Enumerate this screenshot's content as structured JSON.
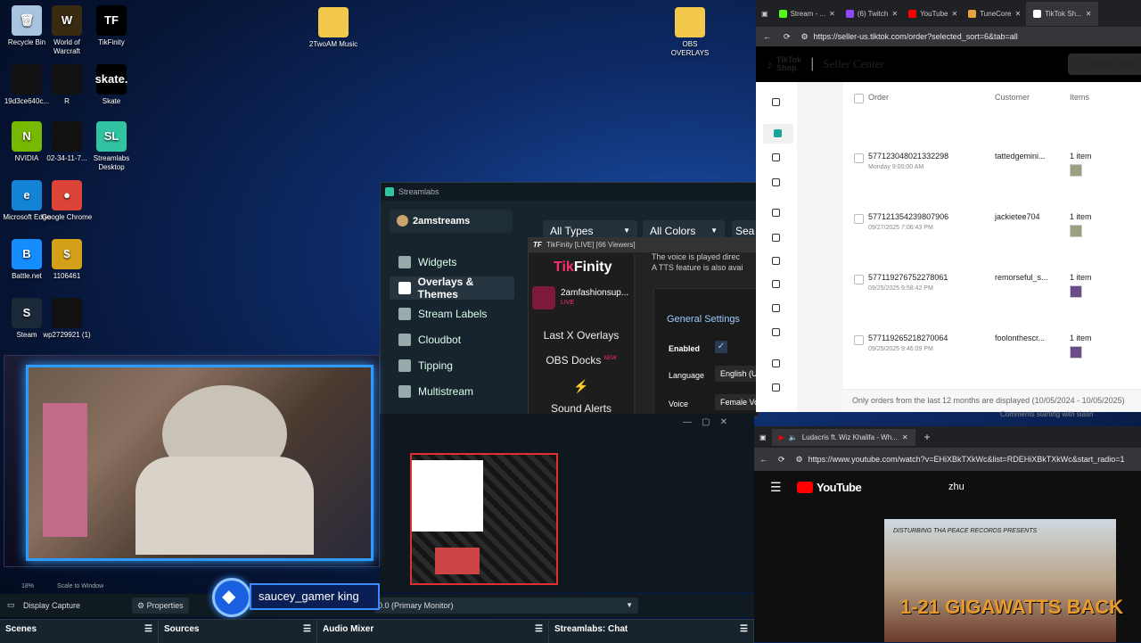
{
  "desktop": {
    "icons": [
      {
        "label": "Recycle Bin",
        "glyph": "🗑",
        "color": "#a8c4e0"
      },
      {
        "label": "World of Warcraft",
        "glyph": "W",
        "color": "#3a2a10"
      },
      {
        "label": "TikFinity",
        "glyph": "TF",
        "color": "#000000"
      },
      {
        "label": "19d3ce640c...",
        "glyph": "",
        "color": "#111111"
      },
      {
        "label": "R",
        "glyph": "",
        "color": "#111111"
      },
      {
        "label": "Skate",
        "glyph": "skate.",
        "color": "#000000"
      },
      {
        "label": "NVIDIA",
        "glyph": "N",
        "color": "#76b900"
      },
      {
        "label": "02-34-11-7...",
        "glyph": "",
        "color": "#111111"
      },
      {
        "label": "Streamlabs Desktop",
        "glyph": "SL",
        "color": "#31c3a2"
      },
      {
        "label": "Microsoft Edge",
        "glyph": "e",
        "color": "#1383d6"
      },
      {
        "label": "Google Chrome",
        "glyph": "●",
        "color": "#db4437"
      },
      {
        "label": "Battle.net",
        "glyph": "B",
        "color": "#148eff"
      },
      {
        "label": "1106461",
        "glyph": "$",
        "color": "#d4a017"
      },
      {
        "label": "Steam",
        "glyph": "S",
        "color": "#1b2838"
      },
      {
        "label": "wp2729921 (1)",
        "glyph": "",
        "color": "#111111"
      },
      {
        "label": "2TwoAM Music",
        "glyph": "",
        "color": "#f2c94c"
      },
      {
        "label": "OBS OVERLAYS",
        "glyph": "",
        "color": "#f2c94c"
      }
    ]
  },
  "streamlabs": {
    "title": "Streamlabs",
    "user": "2amstreams",
    "nav": [
      "Widgets",
      "Overlays & Themes",
      "Stream Labels",
      "Cloudbot",
      "Tipping",
      "Multistream"
    ],
    "filters": {
      "types": "All Types",
      "colors": "All Colors",
      "search": "Sea"
    }
  },
  "tikfinity": {
    "titlebar": "TikFinity [LIVE] [66 Viewers]",
    "brand_a": "Tik",
    "brand_b": "Finity",
    "account": "2amfashionsup...",
    "live": "LIVE",
    "menu": [
      "Last X Overlays",
      "OBS Docks",
      "Sound Alerts"
    ],
    "new_badge": "NEW",
    "text1": "The voice is played direc",
    "text2": "A TTS feature is also avai",
    "settings_title": "General Settings",
    "enabled_label": "Enabled",
    "language_label": "Language",
    "language_value": "English (U",
    "voice_label": "Voice",
    "voice_value": "Female Vo"
  },
  "chrome_tiktok": {
    "tabs": [
      {
        "label": "Stream - ...",
        "color": "#53fc18"
      },
      {
        "label": "(6) Twitch",
        "color": "#9146ff"
      },
      {
        "label": "YouTube",
        "color": "#ff0000"
      },
      {
        "label": "TuneCore",
        "color": "#e8a33d"
      },
      {
        "label": "TikTok Sh...",
        "color": "#ffffff"
      }
    ],
    "url": "https://seller-us.tiktok.com/order?selected_sort=6&tab=all",
    "logo_a": "TikTok",
    "logo_b": "Shop",
    "section": "Seller Center",
    "search": "Search: \"revi",
    "columns": [
      "Order",
      "Customer",
      "Items"
    ],
    "orders": [
      {
        "id": "577123048021332298",
        "date": "Monday 9:00:00 AM",
        "customer": "tattedgemini...",
        "items": "1 item"
      },
      {
        "id": "577121354239807906",
        "date": "09/27/2025 7:06:43 PM",
        "customer": "jackietee704",
        "items": "1 item"
      },
      {
        "id": "577119276752278061",
        "date": "09/25/2025 9:58:42 PM",
        "customer": "remorseful_s...",
        "items": "1 item"
      },
      {
        "id": "577119265218270064",
        "date": "09/25/2025 9:46:09 PM",
        "customer": "foolonthescr...",
        "items": "1 item"
      }
    ],
    "footer": "Only orders from the last 12 months are displayed (10/05/2024 - 10/05/2025)"
  },
  "youtube": {
    "tab": "Ludacris ft. Wiz Khalifa - Wh...",
    "url": "https://www.youtube.com/watch?v=EHiXBkTXkWc&list=RDEHiXBkTXkWc&start_radio=1",
    "brand": "YouTube",
    "search": "zhu",
    "thumb_top": "DISTURBING THA PEACE RECORDS PRESENTS",
    "thumb_big": "1-21 GIGAWATTS BACK",
    "chat_hint": "Comments starting with slash"
  },
  "obs": {
    "zoom": "18%",
    "scale": "Scale to Window",
    "source": "Display Capture",
    "properties": "Properties",
    "monitor": "0.0 (Primary Monitor)",
    "docks": [
      "Scenes",
      "Sources",
      "Audio Mixer",
      "Streamlabs: Chat"
    ]
  },
  "overlay": {
    "username": "saucey_gamer king"
  }
}
